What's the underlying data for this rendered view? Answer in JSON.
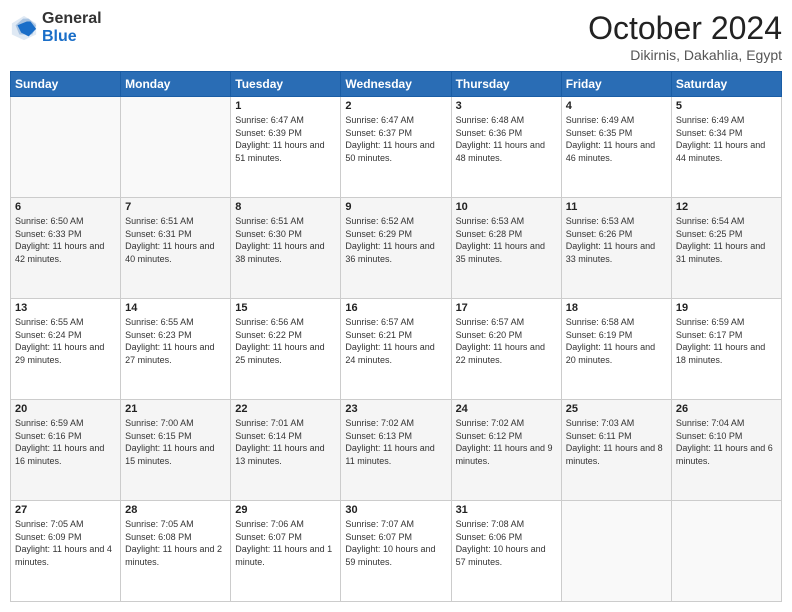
{
  "header": {
    "logo_general": "General",
    "logo_blue": "Blue",
    "month_title": "October 2024",
    "location": "Dikirnis, Dakahlia, Egypt"
  },
  "days_of_week": [
    "Sunday",
    "Monday",
    "Tuesday",
    "Wednesday",
    "Thursday",
    "Friday",
    "Saturday"
  ],
  "weeks": [
    [
      {
        "day": "",
        "sunrise": "",
        "sunset": "",
        "daylight": ""
      },
      {
        "day": "",
        "sunrise": "",
        "sunset": "",
        "daylight": ""
      },
      {
        "day": "1",
        "sunrise": "Sunrise: 6:47 AM",
        "sunset": "Sunset: 6:39 PM",
        "daylight": "Daylight: 11 hours and 51 minutes."
      },
      {
        "day": "2",
        "sunrise": "Sunrise: 6:47 AM",
        "sunset": "Sunset: 6:37 PM",
        "daylight": "Daylight: 11 hours and 50 minutes."
      },
      {
        "day": "3",
        "sunrise": "Sunrise: 6:48 AM",
        "sunset": "Sunset: 6:36 PM",
        "daylight": "Daylight: 11 hours and 48 minutes."
      },
      {
        "day": "4",
        "sunrise": "Sunrise: 6:49 AM",
        "sunset": "Sunset: 6:35 PM",
        "daylight": "Daylight: 11 hours and 46 minutes."
      },
      {
        "day": "5",
        "sunrise": "Sunrise: 6:49 AM",
        "sunset": "Sunset: 6:34 PM",
        "daylight": "Daylight: 11 hours and 44 minutes."
      }
    ],
    [
      {
        "day": "6",
        "sunrise": "Sunrise: 6:50 AM",
        "sunset": "Sunset: 6:33 PM",
        "daylight": "Daylight: 11 hours and 42 minutes."
      },
      {
        "day": "7",
        "sunrise": "Sunrise: 6:51 AM",
        "sunset": "Sunset: 6:31 PM",
        "daylight": "Daylight: 11 hours and 40 minutes."
      },
      {
        "day": "8",
        "sunrise": "Sunrise: 6:51 AM",
        "sunset": "Sunset: 6:30 PM",
        "daylight": "Daylight: 11 hours and 38 minutes."
      },
      {
        "day": "9",
        "sunrise": "Sunrise: 6:52 AM",
        "sunset": "Sunset: 6:29 PM",
        "daylight": "Daylight: 11 hours and 36 minutes."
      },
      {
        "day": "10",
        "sunrise": "Sunrise: 6:53 AM",
        "sunset": "Sunset: 6:28 PM",
        "daylight": "Daylight: 11 hours and 35 minutes."
      },
      {
        "day": "11",
        "sunrise": "Sunrise: 6:53 AM",
        "sunset": "Sunset: 6:26 PM",
        "daylight": "Daylight: 11 hours and 33 minutes."
      },
      {
        "day": "12",
        "sunrise": "Sunrise: 6:54 AM",
        "sunset": "Sunset: 6:25 PM",
        "daylight": "Daylight: 11 hours and 31 minutes."
      }
    ],
    [
      {
        "day": "13",
        "sunrise": "Sunrise: 6:55 AM",
        "sunset": "Sunset: 6:24 PM",
        "daylight": "Daylight: 11 hours and 29 minutes."
      },
      {
        "day": "14",
        "sunrise": "Sunrise: 6:55 AM",
        "sunset": "Sunset: 6:23 PM",
        "daylight": "Daylight: 11 hours and 27 minutes."
      },
      {
        "day": "15",
        "sunrise": "Sunrise: 6:56 AM",
        "sunset": "Sunset: 6:22 PM",
        "daylight": "Daylight: 11 hours and 25 minutes."
      },
      {
        "day": "16",
        "sunrise": "Sunrise: 6:57 AM",
        "sunset": "Sunset: 6:21 PM",
        "daylight": "Daylight: 11 hours and 24 minutes."
      },
      {
        "day": "17",
        "sunrise": "Sunrise: 6:57 AM",
        "sunset": "Sunset: 6:20 PM",
        "daylight": "Daylight: 11 hours and 22 minutes."
      },
      {
        "day": "18",
        "sunrise": "Sunrise: 6:58 AM",
        "sunset": "Sunset: 6:19 PM",
        "daylight": "Daylight: 11 hours and 20 minutes."
      },
      {
        "day": "19",
        "sunrise": "Sunrise: 6:59 AM",
        "sunset": "Sunset: 6:17 PM",
        "daylight": "Daylight: 11 hours and 18 minutes."
      }
    ],
    [
      {
        "day": "20",
        "sunrise": "Sunrise: 6:59 AM",
        "sunset": "Sunset: 6:16 PM",
        "daylight": "Daylight: 11 hours and 16 minutes."
      },
      {
        "day": "21",
        "sunrise": "Sunrise: 7:00 AM",
        "sunset": "Sunset: 6:15 PM",
        "daylight": "Daylight: 11 hours and 15 minutes."
      },
      {
        "day": "22",
        "sunrise": "Sunrise: 7:01 AM",
        "sunset": "Sunset: 6:14 PM",
        "daylight": "Daylight: 11 hours and 13 minutes."
      },
      {
        "day": "23",
        "sunrise": "Sunrise: 7:02 AM",
        "sunset": "Sunset: 6:13 PM",
        "daylight": "Daylight: 11 hours and 11 minutes."
      },
      {
        "day": "24",
        "sunrise": "Sunrise: 7:02 AM",
        "sunset": "Sunset: 6:12 PM",
        "daylight": "Daylight: 11 hours and 9 minutes."
      },
      {
        "day": "25",
        "sunrise": "Sunrise: 7:03 AM",
        "sunset": "Sunset: 6:11 PM",
        "daylight": "Daylight: 11 hours and 8 minutes."
      },
      {
        "day": "26",
        "sunrise": "Sunrise: 7:04 AM",
        "sunset": "Sunset: 6:10 PM",
        "daylight": "Daylight: 11 hours and 6 minutes."
      }
    ],
    [
      {
        "day": "27",
        "sunrise": "Sunrise: 7:05 AM",
        "sunset": "Sunset: 6:09 PM",
        "daylight": "Daylight: 11 hours and 4 minutes."
      },
      {
        "day": "28",
        "sunrise": "Sunrise: 7:05 AM",
        "sunset": "Sunset: 6:08 PM",
        "daylight": "Daylight: 11 hours and 2 minutes."
      },
      {
        "day": "29",
        "sunrise": "Sunrise: 7:06 AM",
        "sunset": "Sunset: 6:07 PM",
        "daylight": "Daylight: 11 hours and 1 minute."
      },
      {
        "day": "30",
        "sunrise": "Sunrise: 7:07 AM",
        "sunset": "Sunset: 6:07 PM",
        "daylight": "Daylight: 10 hours and 59 minutes."
      },
      {
        "day": "31",
        "sunrise": "Sunrise: 7:08 AM",
        "sunset": "Sunset: 6:06 PM",
        "daylight": "Daylight: 10 hours and 57 minutes."
      },
      {
        "day": "",
        "sunrise": "",
        "sunset": "",
        "daylight": ""
      },
      {
        "day": "",
        "sunrise": "",
        "sunset": "",
        "daylight": ""
      }
    ]
  ]
}
